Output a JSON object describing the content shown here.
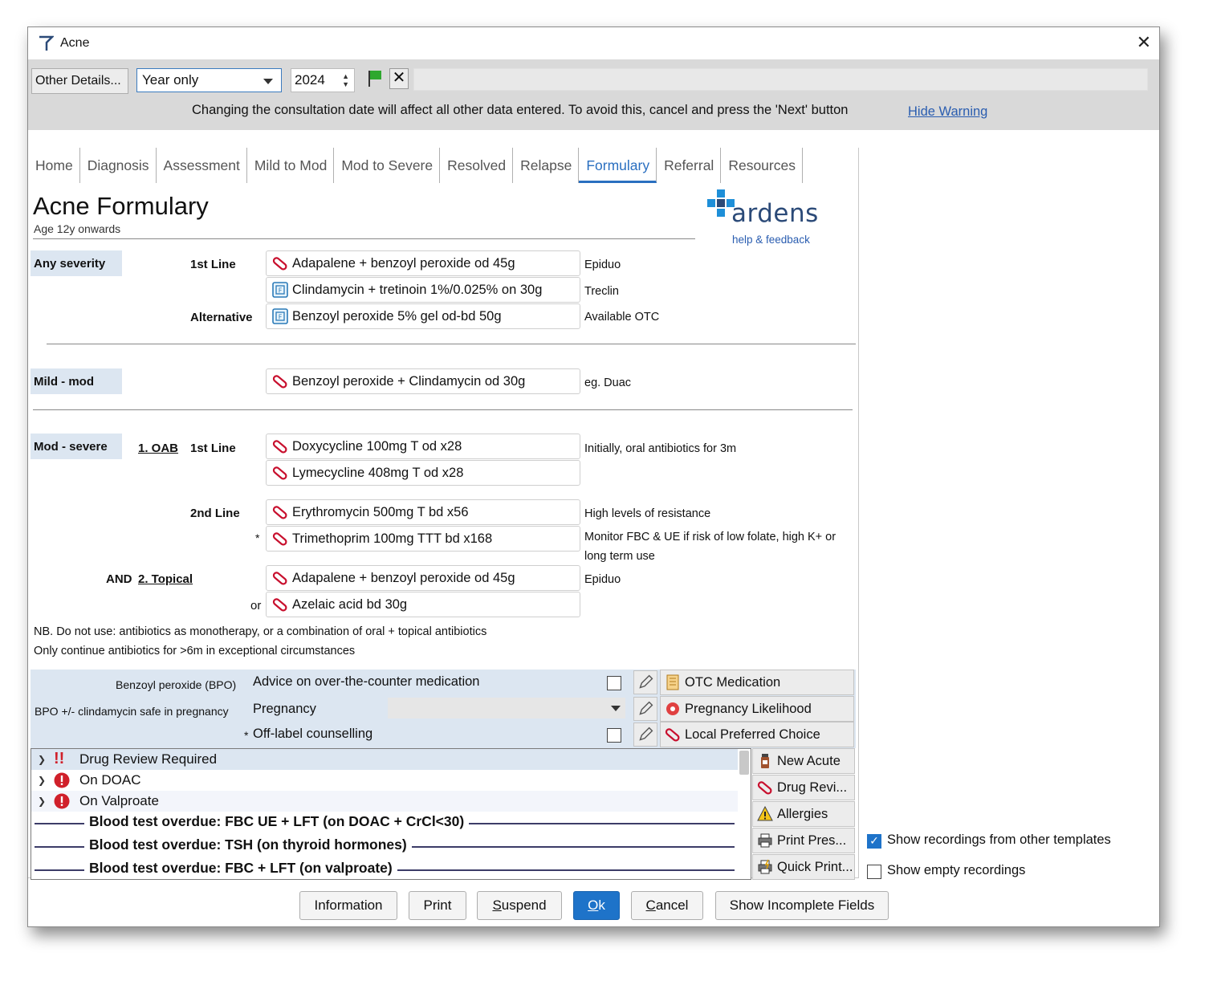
{
  "window": {
    "title": "Acne",
    "close_symbol": "✕"
  },
  "date_bar": {
    "other_details_label": "Other Details...",
    "year_mode": "Year only",
    "year_value": "2024",
    "clear_symbol": "✕",
    "warning": "Changing the consultation date will affect all other data entered. To avoid this, cancel and press the 'Next' button",
    "hide_warning": "Hide Warning"
  },
  "tabs": [
    "Home",
    "Diagnosis",
    "Assessment",
    "Mild to Mod",
    "Mod to Severe",
    "Resolved",
    "Relapse",
    "Formulary",
    "Referral",
    "Resources"
  ],
  "active_tab": "Formulary",
  "page": {
    "title": "Acne Formulary",
    "subtitle": "Age 12y onwards"
  },
  "logo": {
    "name": "ardens",
    "help": "help & feedback"
  },
  "any_severity": {
    "label": "Any severity",
    "first_line_label": "1st Line",
    "alternative_label": "Alternative",
    "meds": [
      {
        "name": "Adapalene + benzoyl peroxide od 45g",
        "note": "Epiduo",
        "icon": "pill-icon"
      },
      {
        "name": "Clindamycin + tretinoin 1%/0.025% on 30g",
        "note": "Treclin",
        "icon": "formulary-icon"
      },
      {
        "name": "Benzoyl peroxide 5% gel od-bd 50g",
        "note": "Available OTC",
        "icon": "formulary-icon"
      }
    ]
  },
  "mild_mod": {
    "label": "Mild - mod",
    "meds": [
      {
        "name": "Benzoyl peroxide + Clindamycin od 30g",
        "note": "eg. Duac",
        "icon": "pill-icon"
      }
    ]
  },
  "mod_severe": {
    "label": "Mod - severe",
    "oab_link": "1. OAB",
    "first_line_label": "1st Line",
    "second_line_label": "2nd Line",
    "and_label": "AND",
    "topical_link": "2. Topical",
    "star": "*",
    "or": "or",
    "meds": [
      {
        "name": "Doxycycline 100mg T od x28",
        "note": "Initially, oral antibiotics for 3m"
      },
      {
        "name": "Lymecycline 408mg T od x28",
        "note": ""
      },
      {
        "name": "Erythromycin 500mg T bd x56",
        "note": "High levels of resistance"
      },
      {
        "name": "Trimethoprim 100mg TTT bd x168",
        "note": "Monitor FBC & UE if risk of low folate, high K+ or"
      },
      {
        "name": "Adapalene + benzoyl peroxide od 45g",
        "note": "Epiduo"
      },
      {
        "name": "Azelaic acid bd 30g",
        "note": ""
      }
    ],
    "trimethoprim_note_cont": "long term use"
  },
  "notes": [
    "NB. Do not use: antibiotics as monotherapy, or a combination of oral + topical antibiotics",
    "Only continue antibiotics for >6m in exceptional circumstances"
  ],
  "band": {
    "rows": [
      {
        "label": "Benzoyl peroxide (BPO)",
        "text": "Advice on over-the-counter medication",
        "side": "OTC Medication"
      },
      {
        "label": "BPO +/- clindamycin safe in pregnancy",
        "text": "Pregnancy",
        "side": "Pregnancy Likelihood"
      },
      {
        "label": "*",
        "text": "Off-label counselling",
        "side": "Local Preferred Choice"
      }
    ]
  },
  "tree": {
    "rows": [
      {
        "icon": "double-exclamation-icon",
        "text": "Drug Review Required"
      },
      {
        "icon": "alert-circle-icon",
        "text": "On DOAC"
      },
      {
        "icon": "alert-circle-icon",
        "text": "On Valproate"
      }
    ],
    "separators": [
      "Blood test overdue: FBC UE + LFT (on DOAC + CrCl<30)",
      "Blood test overdue: TSH (on thyroid hormones)",
      "Blood test overdue: FBC + LFT (on valproate)"
    ]
  },
  "side_actions": [
    "New Acute",
    "Drug Revi...",
    "Allergies",
    "Print Pres...",
    "Quick Print..."
  ],
  "options": {
    "show_other_templates": "Show recordings from other templates",
    "show_other_templates_checked": true,
    "show_empty": "Show empty recordings",
    "show_empty_checked": false
  },
  "footer": [
    "Information",
    "Print",
    "Suspend",
    "Ok",
    "Cancel",
    "Show Incomplete Fields"
  ]
}
